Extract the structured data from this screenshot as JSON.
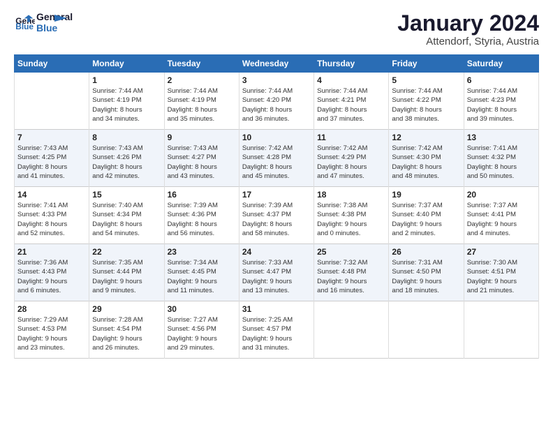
{
  "header": {
    "logo_general": "General",
    "logo_blue": "Blue",
    "month_year": "January 2024",
    "location": "Attendorf, Styria, Austria"
  },
  "days_of_week": [
    "Sunday",
    "Monday",
    "Tuesday",
    "Wednesday",
    "Thursday",
    "Friday",
    "Saturday"
  ],
  "weeks": [
    [
      {
        "day": "",
        "lines": []
      },
      {
        "day": "1",
        "lines": [
          "Sunrise: 7:44 AM",
          "Sunset: 4:19 PM",
          "Daylight: 8 hours",
          "and 34 minutes."
        ]
      },
      {
        "day": "2",
        "lines": [
          "Sunrise: 7:44 AM",
          "Sunset: 4:19 PM",
          "Daylight: 8 hours",
          "and 35 minutes."
        ]
      },
      {
        "day": "3",
        "lines": [
          "Sunrise: 7:44 AM",
          "Sunset: 4:20 PM",
          "Daylight: 8 hours",
          "and 36 minutes."
        ]
      },
      {
        "day": "4",
        "lines": [
          "Sunrise: 7:44 AM",
          "Sunset: 4:21 PM",
          "Daylight: 8 hours",
          "and 37 minutes."
        ]
      },
      {
        "day": "5",
        "lines": [
          "Sunrise: 7:44 AM",
          "Sunset: 4:22 PM",
          "Daylight: 8 hours",
          "and 38 minutes."
        ]
      },
      {
        "day": "6",
        "lines": [
          "Sunrise: 7:44 AM",
          "Sunset: 4:23 PM",
          "Daylight: 8 hours",
          "and 39 minutes."
        ]
      }
    ],
    [
      {
        "day": "7",
        "lines": [
          "Sunrise: 7:43 AM",
          "Sunset: 4:25 PM",
          "Daylight: 8 hours",
          "and 41 minutes."
        ]
      },
      {
        "day": "8",
        "lines": [
          "Sunrise: 7:43 AM",
          "Sunset: 4:26 PM",
          "Daylight: 8 hours",
          "and 42 minutes."
        ]
      },
      {
        "day": "9",
        "lines": [
          "Sunrise: 7:43 AM",
          "Sunset: 4:27 PM",
          "Daylight: 8 hours",
          "and 43 minutes."
        ]
      },
      {
        "day": "10",
        "lines": [
          "Sunrise: 7:42 AM",
          "Sunset: 4:28 PM",
          "Daylight: 8 hours",
          "and 45 minutes."
        ]
      },
      {
        "day": "11",
        "lines": [
          "Sunrise: 7:42 AM",
          "Sunset: 4:29 PM",
          "Daylight: 8 hours",
          "and 47 minutes."
        ]
      },
      {
        "day": "12",
        "lines": [
          "Sunrise: 7:42 AM",
          "Sunset: 4:30 PM",
          "Daylight: 8 hours",
          "and 48 minutes."
        ]
      },
      {
        "day": "13",
        "lines": [
          "Sunrise: 7:41 AM",
          "Sunset: 4:32 PM",
          "Daylight: 8 hours",
          "and 50 minutes."
        ]
      }
    ],
    [
      {
        "day": "14",
        "lines": [
          "Sunrise: 7:41 AM",
          "Sunset: 4:33 PM",
          "Daylight: 8 hours",
          "and 52 minutes."
        ]
      },
      {
        "day": "15",
        "lines": [
          "Sunrise: 7:40 AM",
          "Sunset: 4:34 PM",
          "Daylight: 8 hours",
          "and 54 minutes."
        ]
      },
      {
        "day": "16",
        "lines": [
          "Sunrise: 7:39 AM",
          "Sunset: 4:36 PM",
          "Daylight: 8 hours",
          "and 56 minutes."
        ]
      },
      {
        "day": "17",
        "lines": [
          "Sunrise: 7:39 AM",
          "Sunset: 4:37 PM",
          "Daylight: 8 hours",
          "and 58 minutes."
        ]
      },
      {
        "day": "18",
        "lines": [
          "Sunrise: 7:38 AM",
          "Sunset: 4:38 PM",
          "Daylight: 9 hours",
          "and 0 minutes."
        ]
      },
      {
        "day": "19",
        "lines": [
          "Sunrise: 7:37 AM",
          "Sunset: 4:40 PM",
          "Daylight: 9 hours",
          "and 2 minutes."
        ]
      },
      {
        "day": "20",
        "lines": [
          "Sunrise: 7:37 AM",
          "Sunset: 4:41 PM",
          "Daylight: 9 hours",
          "and 4 minutes."
        ]
      }
    ],
    [
      {
        "day": "21",
        "lines": [
          "Sunrise: 7:36 AM",
          "Sunset: 4:43 PM",
          "Daylight: 9 hours",
          "and 6 minutes."
        ]
      },
      {
        "day": "22",
        "lines": [
          "Sunrise: 7:35 AM",
          "Sunset: 4:44 PM",
          "Daylight: 9 hours",
          "and 9 minutes."
        ]
      },
      {
        "day": "23",
        "lines": [
          "Sunrise: 7:34 AM",
          "Sunset: 4:45 PM",
          "Daylight: 9 hours",
          "and 11 minutes."
        ]
      },
      {
        "day": "24",
        "lines": [
          "Sunrise: 7:33 AM",
          "Sunset: 4:47 PM",
          "Daylight: 9 hours",
          "and 13 minutes."
        ]
      },
      {
        "day": "25",
        "lines": [
          "Sunrise: 7:32 AM",
          "Sunset: 4:48 PM",
          "Daylight: 9 hours",
          "and 16 minutes."
        ]
      },
      {
        "day": "26",
        "lines": [
          "Sunrise: 7:31 AM",
          "Sunset: 4:50 PM",
          "Daylight: 9 hours",
          "and 18 minutes."
        ]
      },
      {
        "day": "27",
        "lines": [
          "Sunrise: 7:30 AM",
          "Sunset: 4:51 PM",
          "Daylight: 9 hours",
          "and 21 minutes."
        ]
      }
    ],
    [
      {
        "day": "28",
        "lines": [
          "Sunrise: 7:29 AM",
          "Sunset: 4:53 PM",
          "Daylight: 9 hours",
          "and 23 minutes."
        ]
      },
      {
        "day": "29",
        "lines": [
          "Sunrise: 7:28 AM",
          "Sunset: 4:54 PM",
          "Daylight: 9 hours",
          "and 26 minutes."
        ]
      },
      {
        "day": "30",
        "lines": [
          "Sunrise: 7:27 AM",
          "Sunset: 4:56 PM",
          "Daylight: 9 hours",
          "and 29 minutes."
        ]
      },
      {
        "day": "31",
        "lines": [
          "Sunrise: 7:25 AM",
          "Sunset: 4:57 PM",
          "Daylight: 9 hours",
          "and 31 minutes."
        ]
      },
      {
        "day": "",
        "lines": []
      },
      {
        "day": "",
        "lines": []
      },
      {
        "day": "",
        "lines": []
      }
    ]
  ]
}
